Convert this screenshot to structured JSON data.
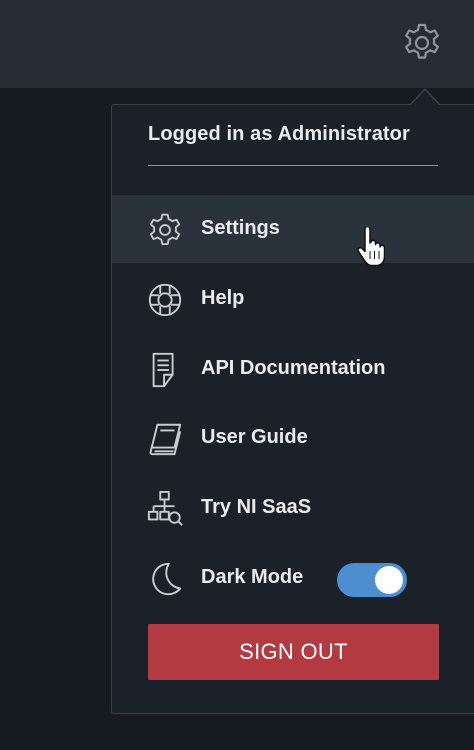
{
  "header": {
    "logged_in_text": "Logged in as Administrator"
  },
  "menu": {
    "items": [
      {
        "label": "Settings",
        "icon": "gear-icon",
        "active": true
      },
      {
        "label": "Help",
        "icon": "lifebuoy-icon",
        "active": false
      },
      {
        "label": "API Documentation",
        "icon": "document-icon",
        "active": false
      },
      {
        "label": "User Guide",
        "icon": "book-icon",
        "active": false
      },
      {
        "label": "Try NI SaaS",
        "icon": "network-search-icon",
        "active": false
      },
      {
        "label": "Dark Mode",
        "icon": "moon-icon",
        "active": false
      }
    ],
    "dark_mode_enabled": true,
    "sign_out_label": "SIGN OUT"
  },
  "colors": {
    "topbar": "#262d35",
    "menu_bg": "#1b2128",
    "active_item_bg": "#2a323b",
    "toggle_on": "#4b8fd1",
    "sign_out_bg": "#b23a40"
  }
}
